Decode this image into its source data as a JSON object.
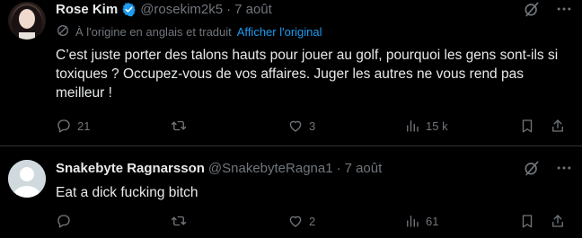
{
  "tweets": [
    {
      "name": "Rose Kim",
      "handle": "@rosekim2k5",
      "dot": "·",
      "date": "7 août",
      "translation_note": "À l'origine en anglais et traduit",
      "show_original": "Afficher l'original",
      "text": "C’est juste porter des talons hauts pour jouer au golf, pourquoi les gens sont-ils si toxiques ? Occupez-vous de vos affaires. Juger les autres ne vous rend pas meilleur !",
      "replies": "21",
      "retweets": "",
      "likes": "3",
      "views": "15 k"
    },
    {
      "name": "Snakebyte Ragnarsson",
      "handle": "@SnakebyteRagna1",
      "dot": "·",
      "date": "7 août",
      "text": "Eat a dick fucking bitch",
      "replies": "",
      "retweets": "",
      "likes": "2",
      "views": "61"
    }
  ],
  "colors": {
    "background": "#000000",
    "text": "#e7e9ea",
    "muted": "#71767b",
    "link": "#1d9bf0",
    "verified": "#1d9bf0",
    "divider": "#2f3336"
  },
  "icons": [
    "verified-badge-icon",
    "grok-icon",
    "more-icon",
    "translate-icon",
    "reply-icon",
    "retweet-icon",
    "like-icon",
    "views-icon",
    "bookmark-icon",
    "share-icon"
  ]
}
